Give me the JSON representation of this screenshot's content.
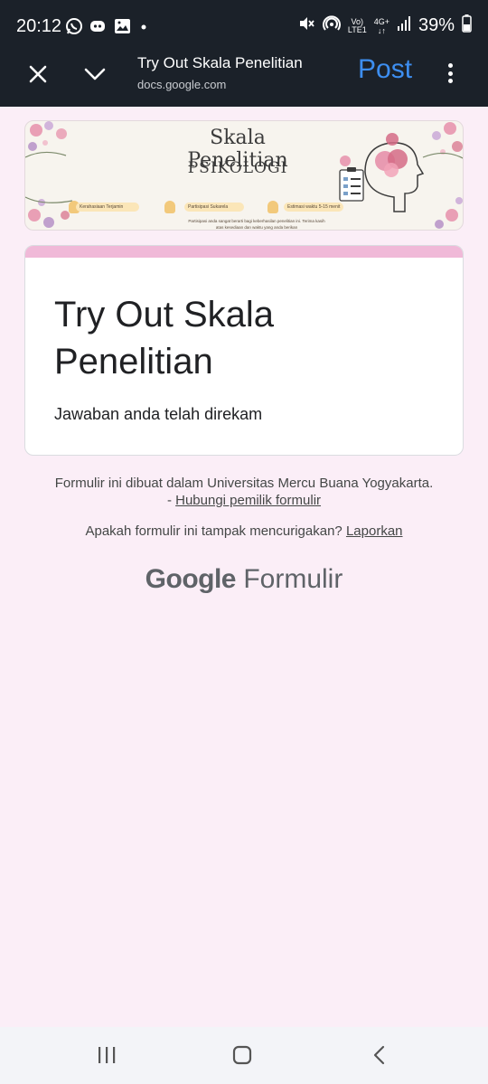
{
  "status_bar": {
    "time": "20:12",
    "battery_percent": "39%",
    "icons": [
      "whatsapp-icon",
      "discord-icon",
      "gallery-icon",
      "notification-dot-icon",
      "mute-icon",
      "hotspot-icon",
      "volte-icon",
      "4g-icon",
      "signal-icon",
      "battery-icon"
    ]
  },
  "browser_bar": {
    "page_title": "Try Out Skala Penelitian",
    "url": "docs.google.com",
    "post_label": "Post",
    "accent_color": "#3d8ef0"
  },
  "banner": {
    "title": "Skala Penelitian",
    "subtitle": "PSIKOLOGI",
    "pills": [
      "Kerahasiaan Terjamin",
      "Partisipasi Sukarela",
      "Estimasi waktu 5-15 menit"
    ],
    "note": "Partisipasi anda sangat berarti bagi keberhasilan penelitian ini. Terima kasih atas kesediaan dan waktu yang anda berikan"
  },
  "form": {
    "title": "Try Out Skala Penelitian",
    "response_message": "Jawaban anda telah direkam",
    "accent_color": "#f0b9d8"
  },
  "footer": {
    "created_in": "Formulir ini dibuat dalam Universitas Mercu Buana Yogyakarta.",
    "contact_prefix": "- ",
    "contact_link": "Hubungi pemilik formulir",
    "suspicious_text": "Apakah formulir ini tampak mencurigakan?",
    "report_link": "Laporkan"
  },
  "brand": {
    "google": "Google",
    "product": "Formulir"
  },
  "navigation": {
    "buttons": [
      "recent-apps",
      "home",
      "back"
    ]
  }
}
